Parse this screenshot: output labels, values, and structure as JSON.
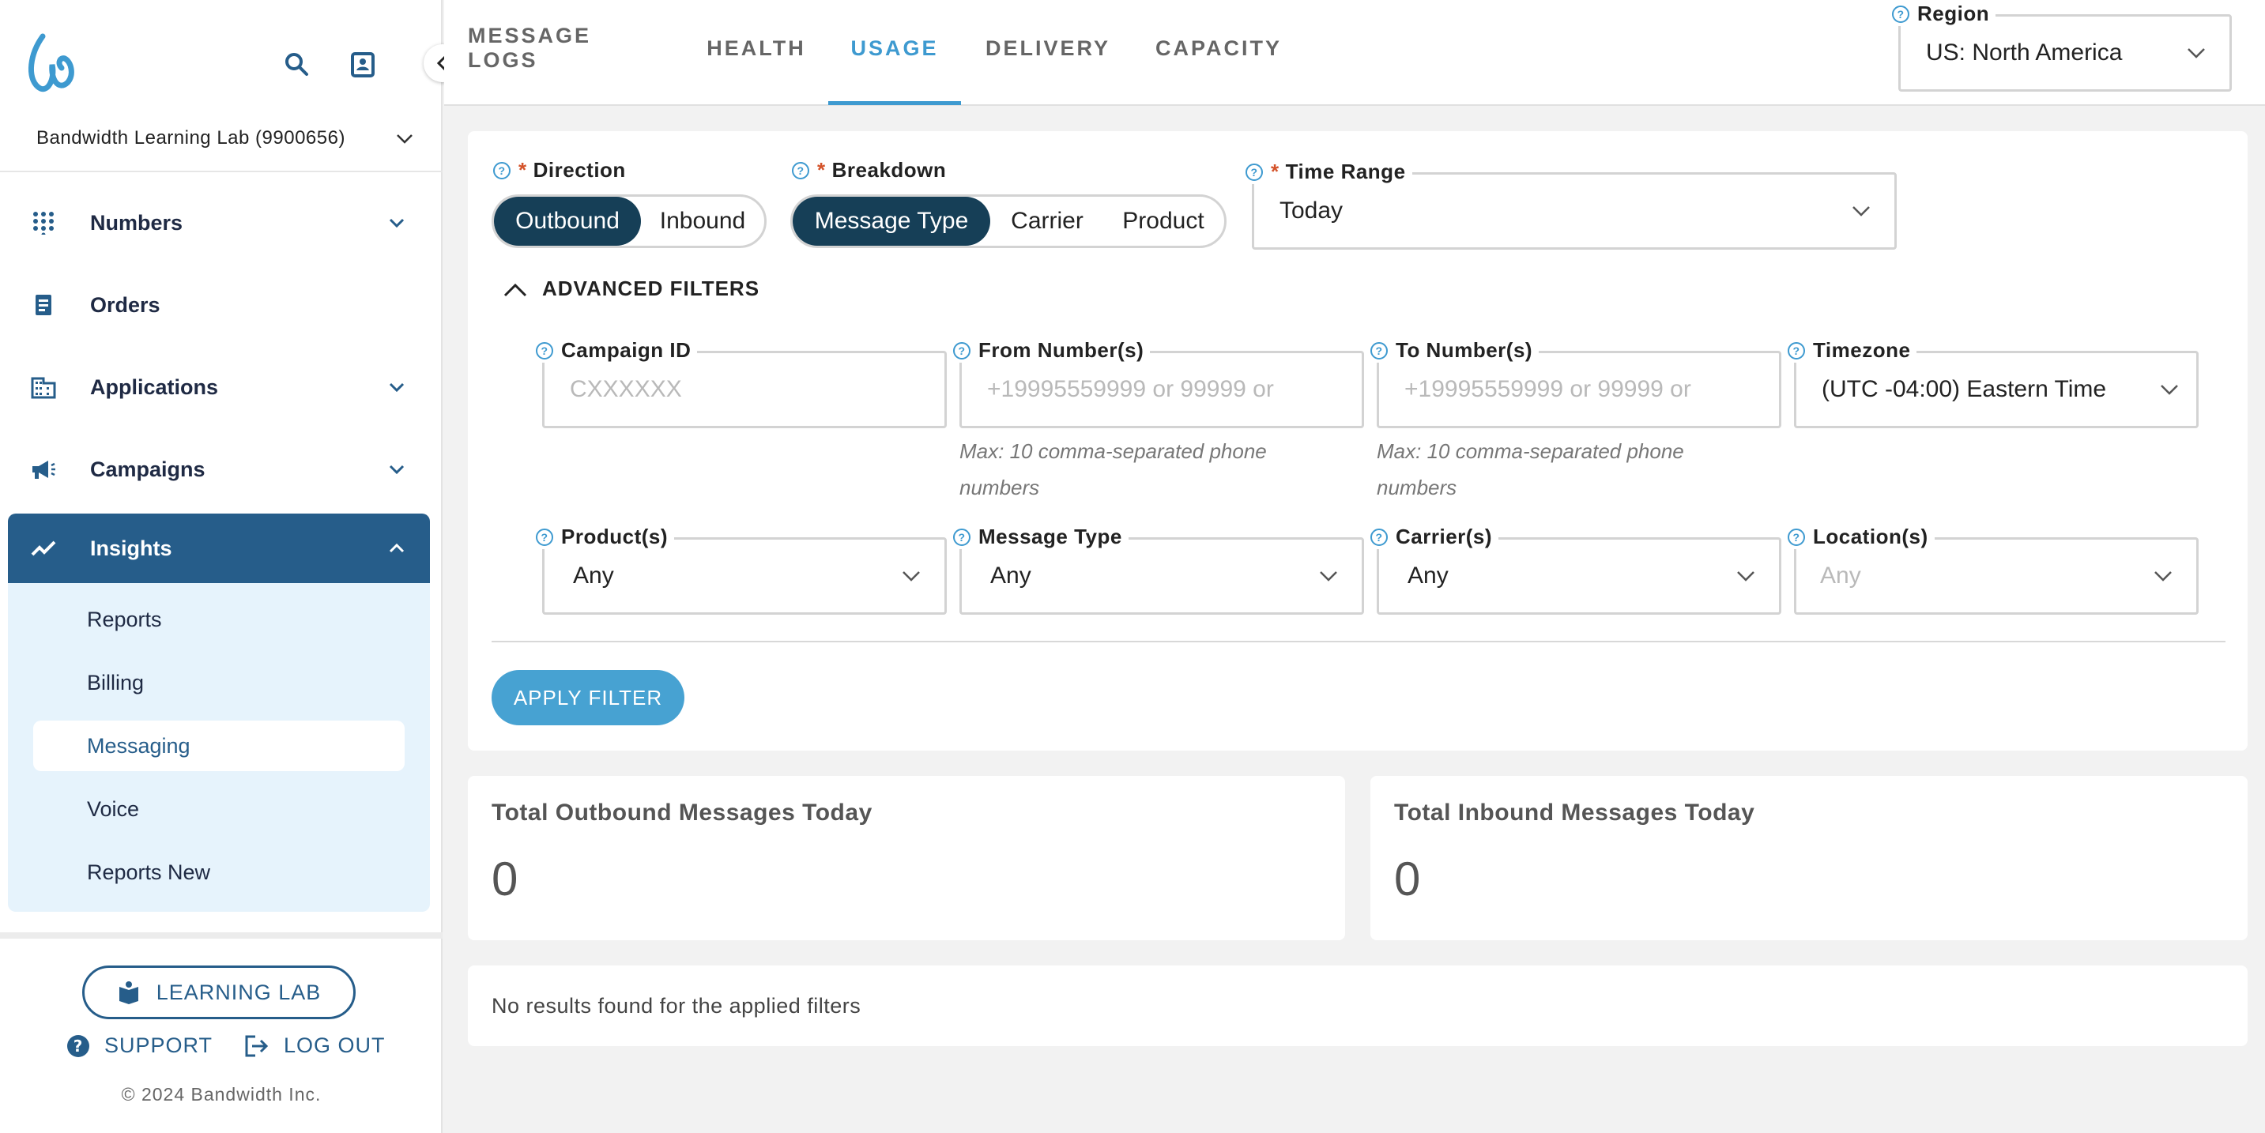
{
  "sidebar": {
    "account": "Bandwidth Learning Lab (9900656)",
    "items": [
      {
        "label": "Numbers",
        "icon": "dialpad-icon"
      },
      {
        "label": "Orders",
        "icon": "receipt-icon"
      },
      {
        "label": "Applications",
        "icon": "building-icon"
      },
      {
        "label": "Campaigns",
        "icon": "megaphone-icon"
      },
      {
        "label": "Insights",
        "icon": "trend-icon"
      }
    ],
    "insights_sub": [
      "Reports",
      "Billing",
      "Messaging",
      "Voice",
      "Reports New"
    ],
    "learning_lab": "LEARNING LAB",
    "support": "SUPPORT",
    "logout": "LOG OUT",
    "copyright": "© 2024 Bandwidth Inc."
  },
  "tabs": [
    "MESSAGE LOGS",
    "HEALTH",
    "USAGE",
    "DELIVERY",
    "CAPACITY"
  ],
  "active_tab": "USAGE",
  "region": {
    "label": "Region",
    "value": "US: North America"
  },
  "filters": {
    "direction": {
      "label": "Direction",
      "options": [
        "Outbound",
        "Inbound"
      ],
      "selected": "Outbound"
    },
    "breakdown": {
      "label": "Breakdown",
      "options": [
        "Message Type",
        "Carrier",
        "Product"
      ],
      "selected": "Message Type"
    },
    "time_range": {
      "label": "Time Range",
      "value": "Today"
    },
    "advanced_label": "ADVANCED FILTERS",
    "campaign_id": {
      "label": "Campaign ID",
      "placeholder": "CXXXXXX"
    },
    "from_numbers": {
      "label": "From Number(s)",
      "placeholder": "+19995559999 or 99999 or",
      "help": "Max: 10 comma-separated phone numbers"
    },
    "to_numbers": {
      "label": "To Number(s)",
      "placeholder": "+19995559999 or 99999 or",
      "help": "Max: 10 comma-separated phone numbers"
    },
    "timezone": {
      "label": "Timezone",
      "value": "(UTC -04:00) Eastern Time"
    },
    "products": {
      "label": "Product(s)",
      "value": "Any"
    },
    "message_type": {
      "label": "Message Type",
      "value": "Any"
    },
    "carriers": {
      "label": "Carrier(s)",
      "value": "Any"
    },
    "locations": {
      "label": "Location(s)",
      "placeholder": "Any"
    },
    "apply": "APPLY FILTER"
  },
  "stats": {
    "outbound": {
      "title": "Total Outbound Messages Today",
      "value": "0"
    },
    "inbound": {
      "title": "Total Inbound Messages Today",
      "value": "0"
    }
  },
  "no_results": "No results found for the applied filters",
  "colors": {
    "brand": "#265d8a",
    "accent": "#3e9ad0",
    "segment_on": "#163f57",
    "required": "#d4532a"
  }
}
